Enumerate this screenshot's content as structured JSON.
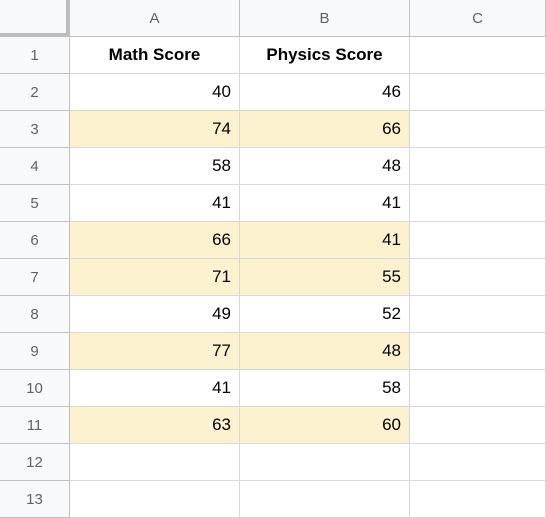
{
  "columns": [
    "A",
    "B",
    "C"
  ],
  "row_numbers": [
    1,
    2,
    3,
    4,
    5,
    6,
    7,
    8,
    9,
    10,
    11,
    12,
    13
  ],
  "headers": {
    "A": "Math Score",
    "B": "Physics Score"
  },
  "chart_data": {
    "type": "table",
    "columns": [
      "Math Score",
      "Physics Score"
    ],
    "rows": [
      [
        40,
        46
      ],
      [
        74,
        66
      ],
      [
        58,
        48
      ],
      [
        41,
        41
      ],
      [
        66,
        41
      ],
      [
        71,
        55
      ],
      [
        49,
        52
      ],
      [
        77,
        48
      ],
      [
        41,
        58
      ],
      [
        63,
        60
      ]
    ],
    "highlighted_rows": [
      2,
      5,
      6,
      8,
      10
    ]
  }
}
